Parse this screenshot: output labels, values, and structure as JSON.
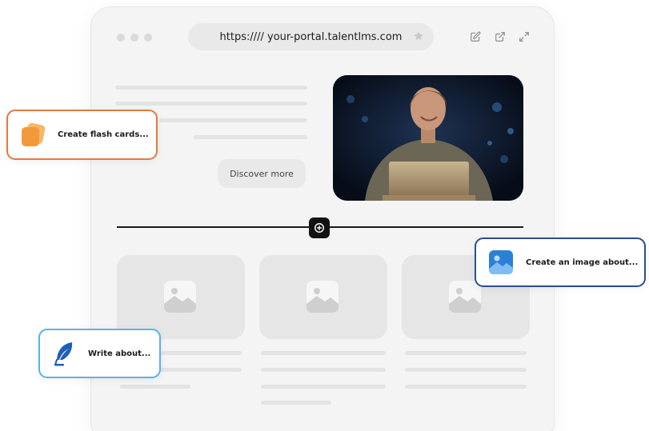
{
  "browser": {
    "url": "https://// your-portal.talentlms.com"
  },
  "hero": {
    "discover_label": "Discover more"
  },
  "chips": {
    "flash_cards": "Create flash cards...",
    "image": "Create an image about...",
    "write": "Write about..."
  },
  "colors": {
    "flash_border": "#e57a3c",
    "image_border": "#2b4d8e",
    "write_border": "#58b4e8",
    "flash_icon": "#f4a23c",
    "image_icon": "#2d7fd6",
    "write_icon": "#1d5fb8"
  },
  "icons": {
    "toolbar": [
      "edit-icon",
      "external-link-icon",
      "expand-icon"
    ],
    "url": "star-icon",
    "divider": "plus-circle-icon",
    "cards": "image-placeholder-icon",
    "flash": "flash-cards-icon",
    "image": "image-icon",
    "write": "feather-pen-icon"
  }
}
